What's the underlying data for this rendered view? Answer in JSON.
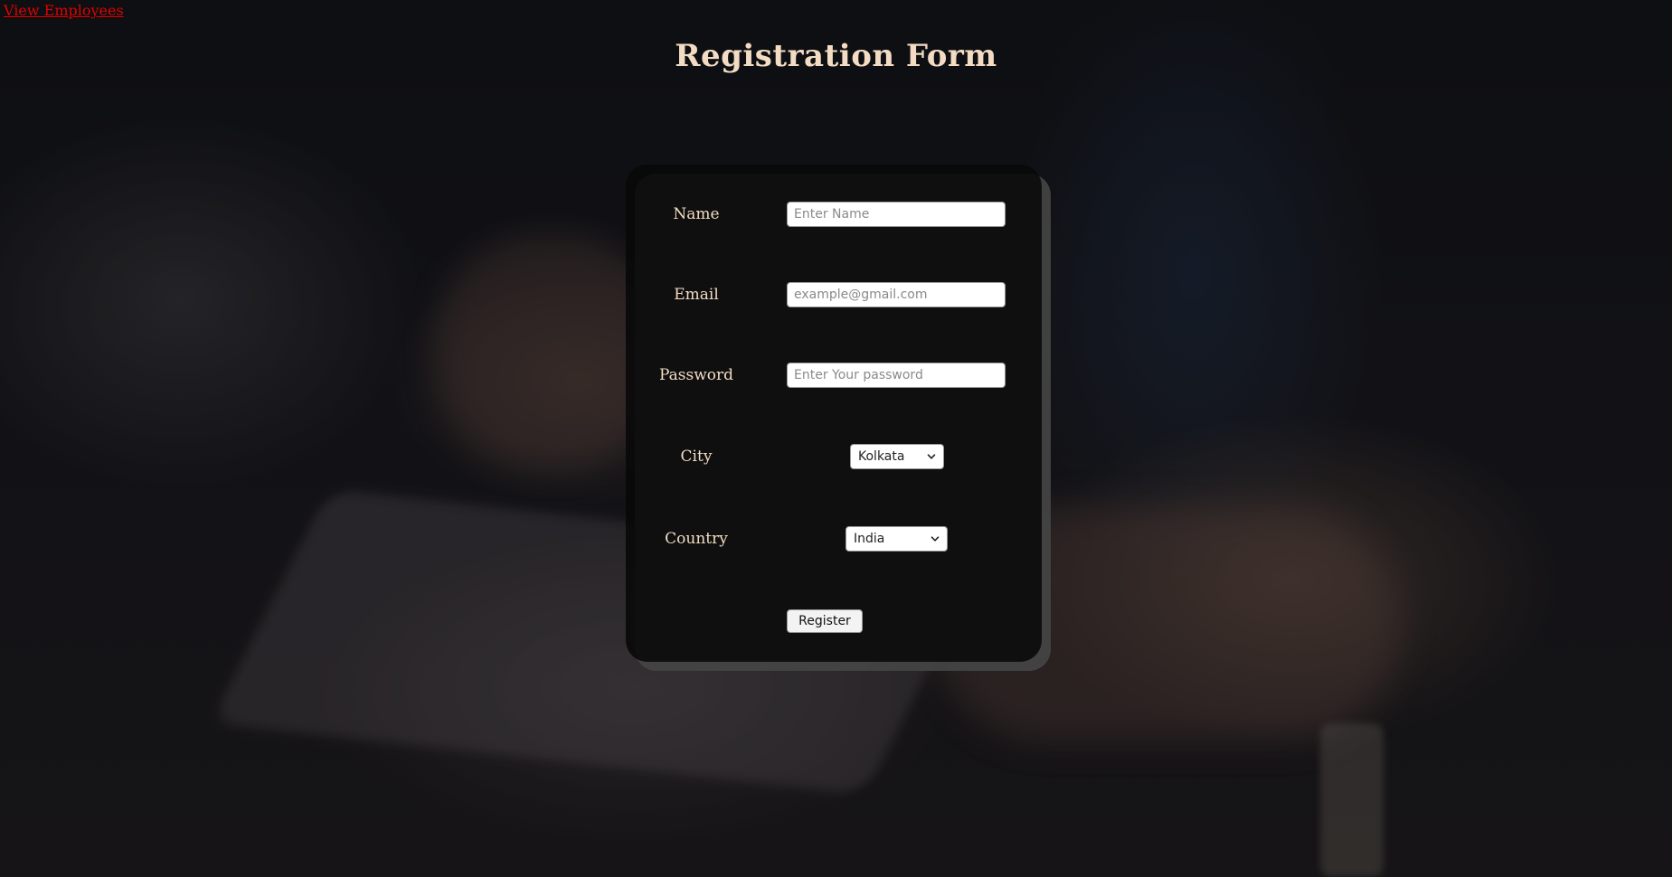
{
  "nav": {
    "view_employees_link": "View Employees"
  },
  "page": {
    "title": "Registration Form"
  },
  "form": {
    "name": {
      "label": "Name",
      "placeholder": "Enter Name",
      "value": ""
    },
    "email": {
      "label": "Email",
      "placeholder": "example@gmail.com",
      "value": ""
    },
    "password": {
      "label": "Password",
      "placeholder": "Enter Your password",
      "value": ""
    },
    "city": {
      "label": "City",
      "selected": "Kolkata"
    },
    "country": {
      "label": "Country",
      "selected": "India"
    },
    "submit_label": "Register"
  },
  "colors": {
    "label_text": "#f3dcc3",
    "link": "#e00000",
    "card_background": "#080808"
  },
  "icons": {
    "select_arrow": "chevron-down-icon"
  }
}
